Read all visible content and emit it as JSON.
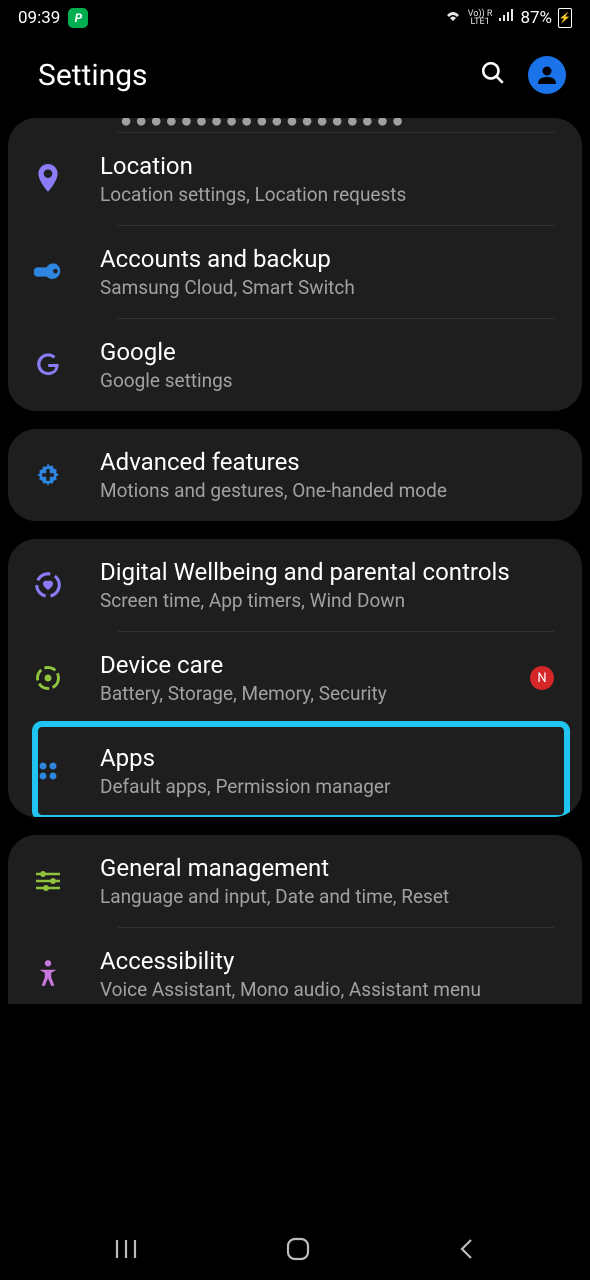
{
  "status": {
    "time": "09:39",
    "network": "LTE1",
    "roam": "Vo)) R",
    "battery": "87%"
  },
  "header": {
    "title": "Settings"
  },
  "partial_top": ". . . . . . . . . . . . . . . . . . . . . g . .",
  "groups": [
    {
      "id": "g1",
      "has_partial_top": true,
      "rows": [
        {
          "id": "location",
          "title": "Location",
          "subtitle": "Location settings, Location requests",
          "icon": "location-pin",
          "icon_color": "#8a7cf4",
          "badge": null
        },
        {
          "id": "accounts",
          "title": "Accounts and backup",
          "subtitle": "Samsung Cloud, Smart Switch",
          "icon": "key",
          "icon_color": "#2f86e0",
          "badge": null
        },
        {
          "id": "google",
          "title": "Google",
          "subtitle": "Google settings",
          "icon": "google-g",
          "icon_color": "#8a7cf4",
          "badge": null
        }
      ]
    },
    {
      "id": "g2",
      "rows": [
        {
          "id": "advanced",
          "title": "Advanced features",
          "subtitle": "Motions and gestures, One-handed mode",
          "icon": "gear-plus",
          "icon_color": "#2f86e0",
          "badge": null
        }
      ]
    },
    {
      "id": "g3",
      "rows": [
        {
          "id": "wellbeing",
          "title": "Digital Wellbeing and parental controls",
          "subtitle": "Screen time, App timers, Wind Down",
          "icon": "wellbeing",
          "icon_color": "#8a7cf4",
          "badge": null
        },
        {
          "id": "devicecare",
          "title": "Device care",
          "subtitle": "Battery, Storage, Memory, Security",
          "icon": "device-care",
          "icon_color": "#8fc43c",
          "badge": "N"
        },
        {
          "id": "apps",
          "title": "Apps",
          "subtitle": "Default apps, Permission manager",
          "icon": "apps-grid",
          "icon_color": "#2f86e0",
          "badge": null,
          "highlighted": true
        }
      ]
    },
    {
      "id": "g4",
      "cut_bottom": true,
      "rows": [
        {
          "id": "general",
          "title": "General management",
          "subtitle": "Language and input, Date and time, Reset",
          "icon": "sliders",
          "icon_color": "#8fc43c",
          "badge": null
        },
        {
          "id": "accessibility",
          "title": "Accessibility",
          "subtitle": "Voice Assistant, Mono audio, Assistant menu",
          "icon": "accessibility",
          "icon_color": "#c678dd",
          "badge": null,
          "cut": true
        }
      ]
    }
  ]
}
